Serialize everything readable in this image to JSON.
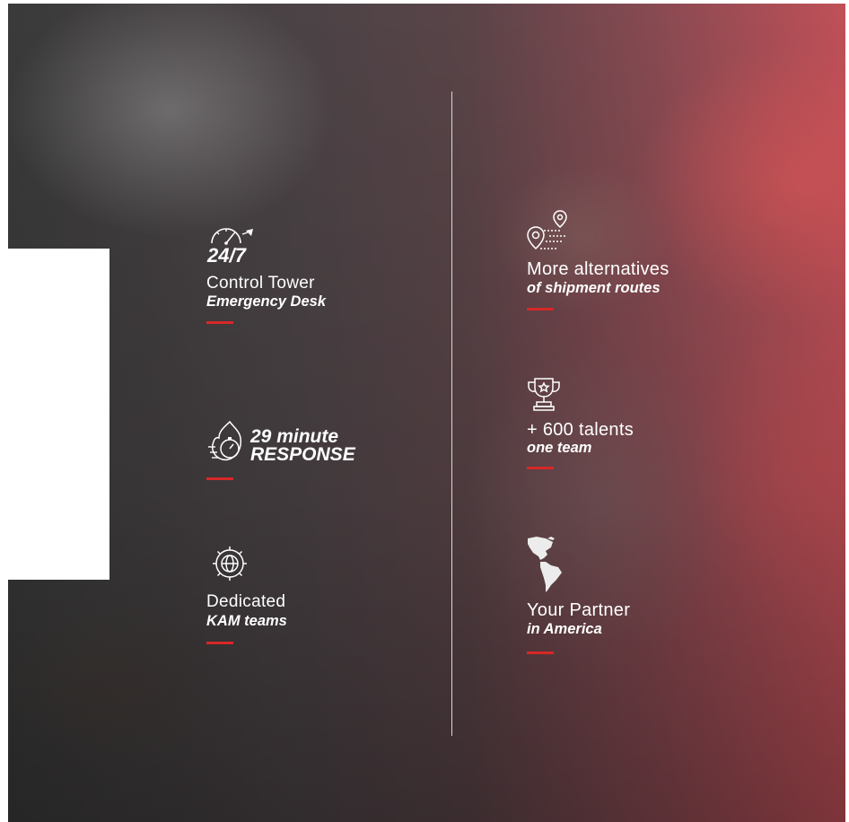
{
  "items": {
    "control_tower": {
      "big": "24/7",
      "line1": "Control Tower",
      "line2": "Emergency Desk",
      "icon": "clock-speed-icon"
    },
    "response": {
      "line1": "29 minute",
      "line2": "RESPONSE",
      "icon": "stopwatch-fire-icon"
    },
    "kam": {
      "line1": "Dedicated",
      "line2": "KAM teams",
      "icon": "gear-globe-icon"
    },
    "routes": {
      "line1": "More alternatives",
      "line2": "of shipment routes",
      "icon": "route-pin-icon"
    },
    "talents": {
      "line1": "+ 600 talents",
      "line2": "one team",
      "icon": "trophy-icon"
    },
    "partner": {
      "line1": "Your Partner",
      "line2": "in America",
      "icon": "americas-map-icon"
    }
  },
  "colors": {
    "accent": "#d62828",
    "text": "#ffffff",
    "gradient_end": "#c05058"
  }
}
